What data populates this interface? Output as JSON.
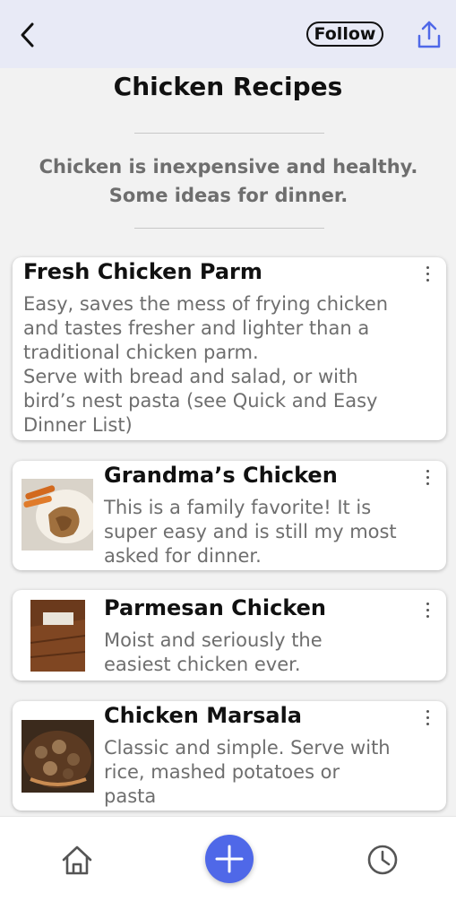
{
  "header": {
    "follow_label": "Follow",
    "icons": [
      "chevron-left-icon",
      "share-icon"
    ]
  },
  "page": {
    "title": "Chicken Recipes",
    "subtitle": "Chicken is inexpensive and healthy.\nSome ideas for dinner."
  },
  "recipes": [
    {
      "title": "Fresh Chicken Parm",
      "description": "Easy, saves the mess of frying chicken\nand tastes fresher and lighter than a\ntraditional chicken parm.\nServe with bread and salad, or with\nbird’s nest pasta (see Quick and Easy\nDinner List)",
      "has_image": false
    },
    {
      "title": "Grandma’s Chicken",
      "description": "This is a family favorite! It is\nsuper easy and is still my most\nasked for dinner.",
      "has_image": true
    },
    {
      "title": "Parmesan Chicken",
      "description": "Moist and seriously the\neasiest chicken ever.",
      "has_image": true
    },
    {
      "title": "Chicken Marsala",
      "description": "Classic and simple. Serve with\nrice, mashed potatoes or\npasta",
      "has_image": true
    }
  ],
  "tabbar": {
    "icons": [
      "home-icon",
      "plus-icon",
      "clock-icon"
    ]
  },
  "colors": {
    "accent": "#4f68e8",
    "header_bg": "#e8eaf6",
    "page_bg": "#f2f2f2"
  }
}
